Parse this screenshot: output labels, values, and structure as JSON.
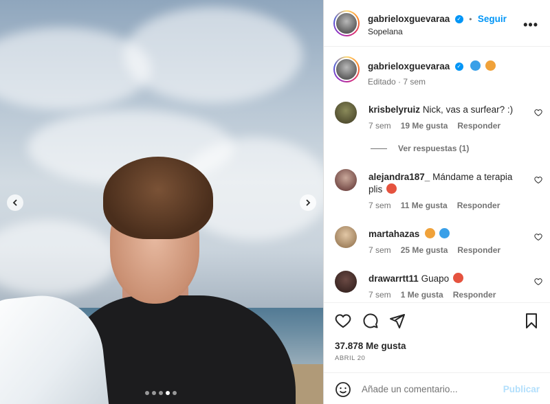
{
  "post": {
    "author": "gabrieloxguevaraa",
    "follow_label": "Seguir",
    "separator": "•",
    "location": "Sopelana",
    "more_label": "•••"
  },
  "caption": {
    "author": "gabrieloxguevaraa",
    "meta": "Editado · 7 sem"
  },
  "photo": {
    "carousel_total": 5,
    "carousel_active": 4
  },
  "comments": [
    {
      "user": "krisbelyruiz",
      "text": "Nick, vas a surfear? :)",
      "age": "7 sem",
      "likes": "19 Me gusta",
      "reply": "Responder"
    },
    {
      "user": "alejandra187_",
      "text": "Mándame a terapia plis",
      "age": "7 sem",
      "likes": "11 Me gusta",
      "reply": "Responder"
    },
    {
      "user": "martahazas",
      "text": "",
      "age": "7 sem",
      "likes": "25 Me gusta",
      "reply": "Responder"
    },
    {
      "user": "drawarrtt11",
      "text": "Guapo",
      "age": "7 sem",
      "likes": "1 Me gusta",
      "reply": "Responder"
    }
  ],
  "view_replies": "Ver respuestas (1)",
  "footer": {
    "likes": "37.878 Me gusta",
    "date": "ABRIL 20",
    "comment_placeholder": "Añade un comentario...",
    "publish": "Publicar"
  },
  "colors": {
    "accent": "#0095f6",
    "text": "#262626",
    "muted": "#737373",
    "publish_disabled": "#b2dffc"
  }
}
